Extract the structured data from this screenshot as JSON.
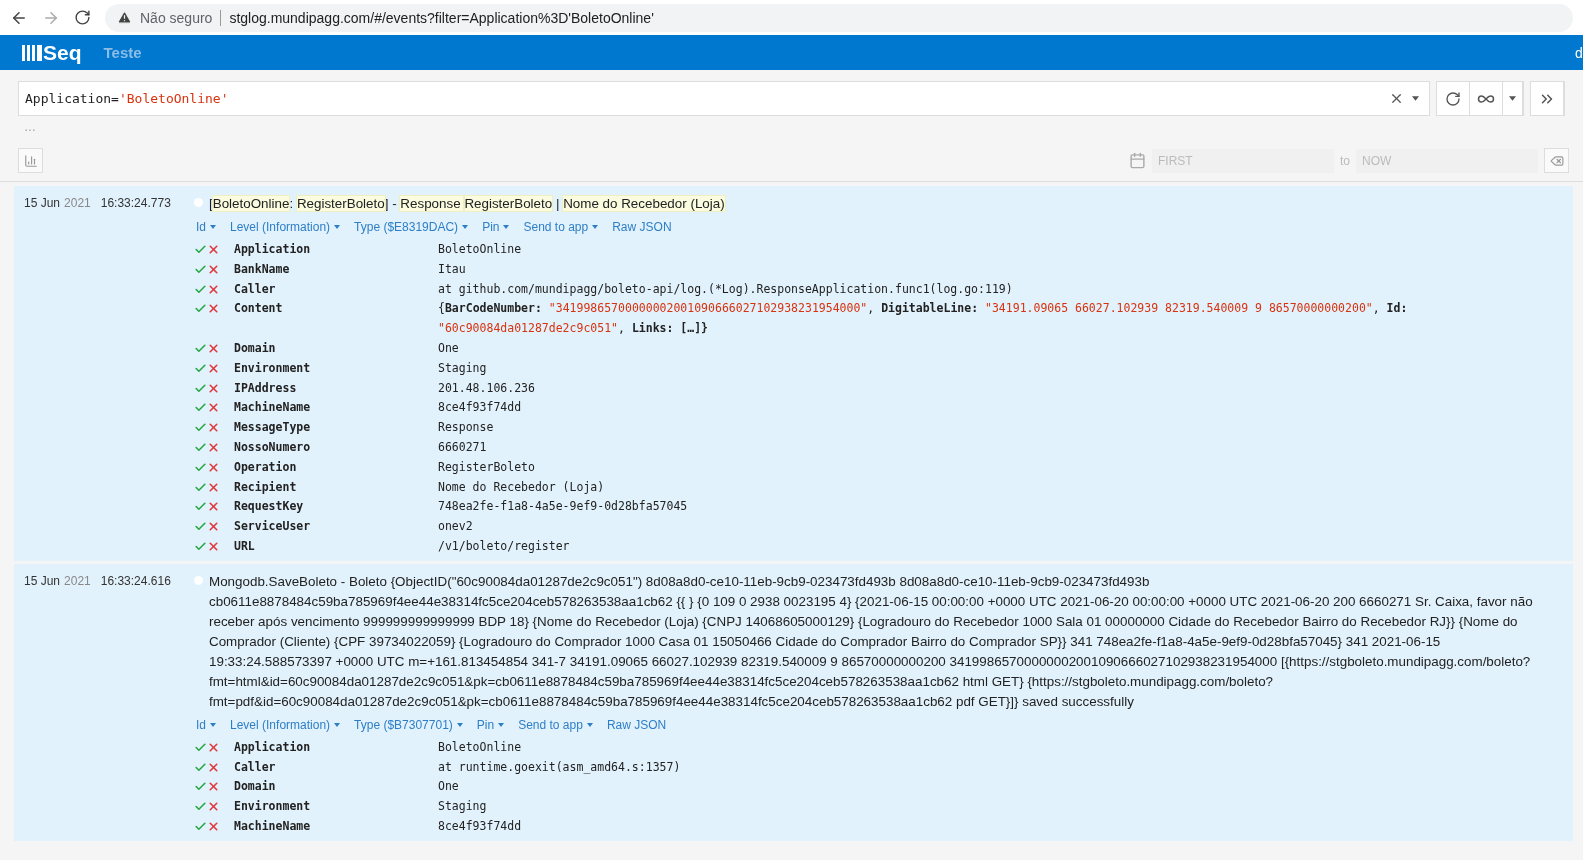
{
  "browser": {
    "security": "Não seguro",
    "url": "stglog.mundipagg.com/#/events?filter=Application%3D'BoletoOnline'"
  },
  "header": {
    "logo": "Seq",
    "workspace": "Teste",
    "user": "d"
  },
  "filter": {
    "parts": [
      {
        "kind": "plain",
        "text": "Application="
      },
      {
        "kind": "string",
        "text": "'BoletoOnline'"
      }
    ],
    "more": "…"
  },
  "range": {
    "from_placeholder": "FIRST",
    "separator": "to",
    "to_placeholder": "NOW"
  },
  "events": [
    {
      "date": "15 Jun",
      "year": "2021",
      "time": "16:33:24.773",
      "message": [
        {
          "text": "[",
          "hl": false
        },
        {
          "text": "BoletoOnline",
          "hl": true
        },
        {
          "text": ": ",
          "hl": false
        },
        {
          "text": "RegisterBoleto",
          "hl": true
        },
        {
          "text": "] - ",
          "hl": false
        },
        {
          "text": "Response ",
          "hl": true
        },
        {
          "text": "RegisterBoleto",
          "hl": true
        },
        {
          "text": " | ",
          "hl": false
        },
        {
          "text": "Nome do Recebedor (Loja)",
          "hl": true
        }
      ],
      "actions": [
        {
          "label": "Id",
          "dropdown": true
        },
        {
          "label": "Level (Information)",
          "dropdown": true
        },
        {
          "label": "Type ($E8319DAC)",
          "dropdown": true
        },
        {
          "label": "Pin",
          "dropdown": true
        },
        {
          "label": "Send to app",
          "dropdown": true
        },
        {
          "label": "Raw JSON",
          "dropdown": false
        }
      ],
      "properties": [
        {
          "name": "Application",
          "value": "BoletoOnline"
        },
        {
          "name": "BankName",
          "value": "Itau"
        },
        {
          "name": "Caller",
          "value": "at github.com/mundipagg/boleto-api/log.(*Log).ResponseApplication.func1(log.go:119)"
        },
        {
          "name": "Content",
          "parts": [
            {
              "kind": "plain",
              "text": "{"
            },
            {
              "kind": "key",
              "text": "BarCodeNumber: "
            },
            {
              "kind": "string",
              "text": "\"34199865700000002001090666027102938231954000\""
            },
            {
              "kind": "plain",
              "text": ", "
            },
            {
              "kind": "key",
              "text": "DigitableLine: "
            },
            {
              "kind": "string",
              "text": "\"34191.09065 66027.102939 82319.540009 9 86570000000200\""
            },
            {
              "kind": "plain",
              "text": ", "
            },
            {
              "kind": "key",
              "text": "Id: "
            },
            {
              "kind": "string",
              "text": "\"60c90084da01287de2c9c051\""
            },
            {
              "kind": "plain",
              "text": ", "
            },
            {
              "kind": "key",
              "text": "Links: "
            },
            {
              "kind": "key",
              "text": "[…]}"
            }
          ]
        },
        {
          "name": "Domain",
          "value": "One"
        },
        {
          "name": "Environment",
          "value": "Staging"
        },
        {
          "name": "IPAddress",
          "value": "201.48.106.236"
        },
        {
          "name": "MachineName",
          "value": "8ce4f93f74dd"
        },
        {
          "name": "MessageType",
          "value": "Response"
        },
        {
          "name": "NossoNumero",
          "value": "6660271"
        },
        {
          "name": "Operation",
          "value": "RegisterBoleto"
        },
        {
          "name": "Recipient",
          "value": "Nome do Recebedor (Loja)"
        },
        {
          "name": "RequestKey",
          "value": "748ea2fe-f1a8-4a5e-9ef9-0d28bfa57045"
        },
        {
          "name": "ServiceUser",
          "value": "onev2"
        },
        {
          "name": "URL",
          "value": "/v1/boleto/register"
        }
      ]
    },
    {
      "date": "15 Jun",
      "year": "2021",
      "time": "16:33:24.616",
      "message": [
        {
          "text": "Mongodb.SaveBoleto - Boleto {ObjectID(\"60c90084da01287de2c9c051\") 8d08a8d0-ce10-11eb-9cb9-023473fd493b 8d08a8d0-ce10-11eb-9cb9-023473fd493b cb0611e8878484c59ba785969f4ee44e38314fc5ce204ceb578263538aa1cb62 {{ } {0 109 0 2938 0023195 4} {2021-06-15 00:00:00 +0000 UTC 2021-06-20 00:00:00 +0000 UTC 2021-06-20 200 6660271 Sr. Caixa, favor não receber após vencimento 999999999999999 BDP 18} {Nome do Recebedor (Loja) {CNPJ 14068605000129} {Logradouro do Recebedor 1000 Sala 01 00000000 Cidade do Recebedor Bairro do Recebedor RJ}} {Nome do Comprador (Cliente) {CPF 39734022059} {Logradouro do Comprador 1000 Casa 01 15050466 Cidade do Comprador Bairro do Comprador SP}} 341 748ea2fe-f1a8-4a5e-9ef9-0d28bfa57045} 341 2021-06-15 19:33:24.588573397 +0000 UTC m=+161.813454854 341-7 34191.09065 66027.102939 82319.540009 9 86570000000200 34199865700000002001090666027102938231954000 [{https://stgboleto.mundipagg.com/boleto?fmt=html&id=60c90084da01287de2c9c051&pk=cb0611e8878484c59ba785969f4ee44e38314fc5ce204ceb578263538aa1cb62 html GET} {https://stgboleto.mundipagg.com/boleto?fmt=pdf&id=60c90084da01287de2c9c051&pk=cb0611e8878484c59ba785969f4ee44e38314fc5ce204ceb578263538aa1cb62 pdf GET}]} saved successfully",
          "hl": false
        }
      ],
      "actions": [
        {
          "label": "Id",
          "dropdown": true
        },
        {
          "label": "Level (Information)",
          "dropdown": true
        },
        {
          "label": "Type ($B7307701)",
          "dropdown": true
        },
        {
          "label": "Pin",
          "dropdown": true
        },
        {
          "label": "Send to app",
          "dropdown": true
        },
        {
          "label": "Raw JSON",
          "dropdown": false
        }
      ],
      "properties": [
        {
          "name": "Application",
          "value": "BoletoOnline"
        },
        {
          "name": "Caller",
          "value": "at runtime.goexit(asm_amd64.s:1357)"
        },
        {
          "name": "Domain",
          "value": "One"
        },
        {
          "name": "Environment",
          "value": "Staging"
        },
        {
          "name": "MachineName",
          "value": "8ce4f93f74dd"
        }
      ]
    }
  ]
}
